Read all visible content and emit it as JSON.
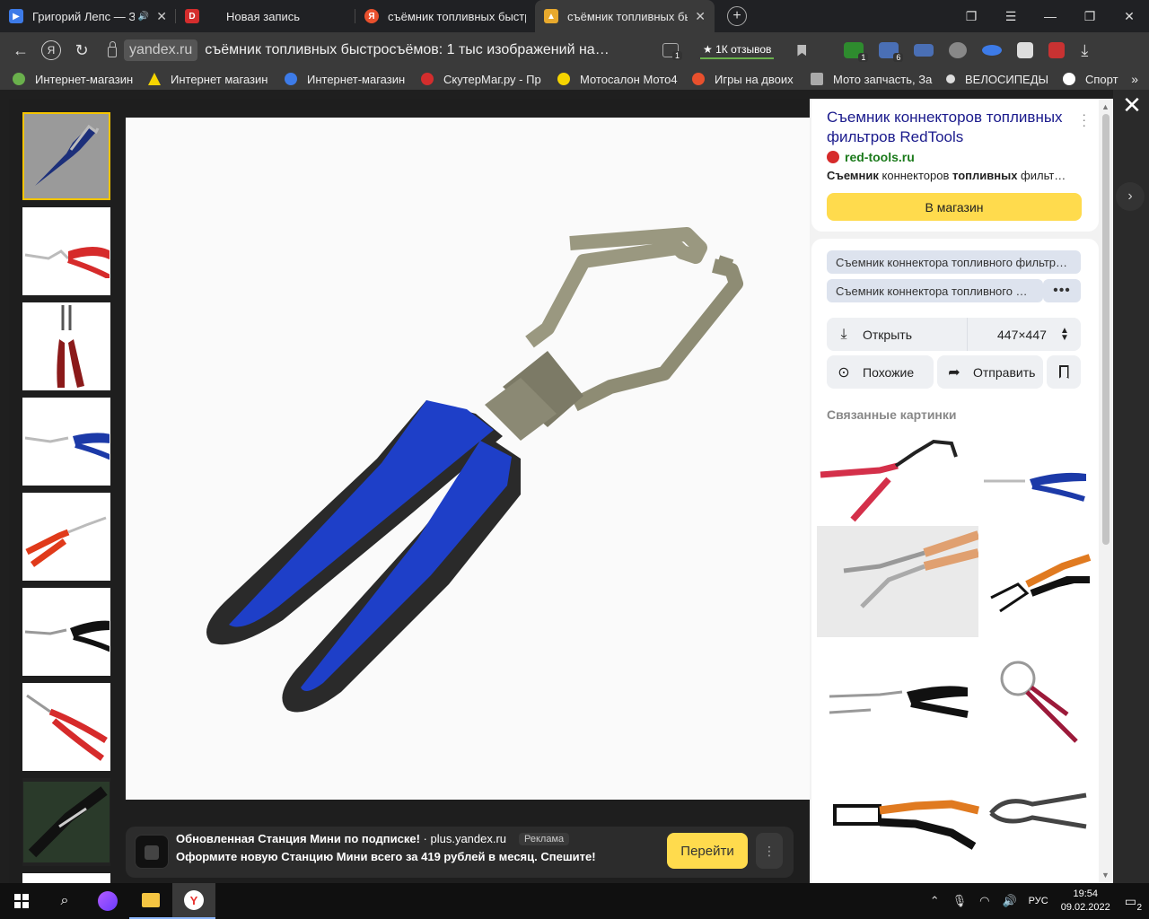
{
  "tabs": [
    {
      "title": "Григорий Лепс — З…",
      "favicon": "play-icon",
      "color": "#3d7be8",
      "active": false
    },
    {
      "title": "Новая запись",
      "favicon": "dzen-icon",
      "color": "#d42d2d",
      "active": false
    },
    {
      "title": "съёмник топливных быстр",
      "favicon": "yandex-icon",
      "color": "#e8502d",
      "active": false
    },
    {
      "title": "съёмник топливных бы",
      "favicon": "images-icon",
      "color": "#e8a92d",
      "active": true
    }
  ],
  "address": {
    "domain": "yandex.ru",
    "title": "съёмник топливных быстросъёмов: 1 тыс изображений на…",
    "reviews": "★ 1К отзывов",
    "ext_badges": [
      "1",
      "1",
      "6"
    ]
  },
  "bookmarks": [
    {
      "label": "Интернет-магазин",
      "color": "#6ab04c"
    },
    {
      "label": "Интернет магазин",
      "color": "#f5d400"
    },
    {
      "label": "Интернет-магазин",
      "color": "#3d7be8"
    },
    {
      "label": "СкутерМаг.ру - Пр",
      "color": "#d42d2d"
    },
    {
      "label": "Мотосалон Мото4",
      "color": "#f5d400"
    },
    {
      "label": "Игры на двоих",
      "color": "#e8502d"
    },
    {
      "label": "Мото запчасть, За",
      "color": "#aaaaaa"
    },
    {
      "label": "ВЕЛОСИПЕДЫ",
      "color": "#dddddd"
    },
    {
      "label": "Спорт",
      "color": "#ffffff"
    }
  ],
  "ad": {
    "title": "Обновленная Станция Мини по подписке!",
    "domain": "· plus.yandex.ru",
    "tag": "Реклама",
    "text": "Оформите новую Станцию Мини всего за 419 рублей в месяц. Спешите!",
    "button": "Перейти"
  },
  "panel": {
    "title": "Съемник коннекторов топливных фильтров RedTools",
    "site": "red-tools.ru",
    "desc_bold1": "Съемник",
    "desc_mid": " коннекторов ",
    "desc_bold2": "топливных",
    "desc_end": " фильт…",
    "shop_button": "В магазин",
    "chips": [
      "Съемник коннектора топливного фильтр…",
      "Съемник коннектора топливного …"
    ],
    "open_label": "Открыть",
    "size_label": "447×447",
    "similar_label": "Похожие",
    "share_label": "Отправить",
    "related_title": "Связанные картинки"
  },
  "taskbar": {
    "lang": "РУС",
    "time": "19:54",
    "date": "09.02.2022",
    "notif": "2"
  },
  "colors": {
    "accent_yellow": "#ffdb4d",
    "link_blue": "#1a1a8c",
    "site_green": "#1b7a1b"
  }
}
